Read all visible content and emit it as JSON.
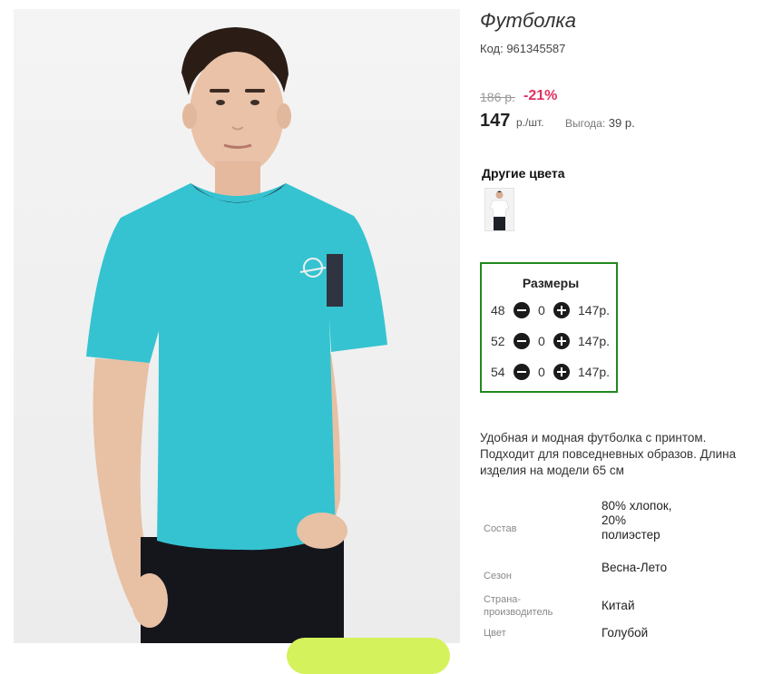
{
  "product": {
    "title": "Футболка",
    "code": "Код: 961345587",
    "old_price": "186 р.",
    "discount": "-21%",
    "price": "147",
    "price_unit": "р./шт.",
    "saving_label": "Выгода:",
    "saving_value": "39 р."
  },
  "colors": {
    "title": "Другие цвета"
  },
  "sizes": {
    "title": "Размеры",
    "rows": [
      {
        "size": "48",
        "qty": "0",
        "price": "147р."
      },
      {
        "size": "52",
        "qty": "0",
        "price": "147р."
      },
      {
        "size": "54",
        "qty": "0",
        "price": "147р."
      }
    ]
  },
  "description": "Удобная и модная футболка с принтом. Подходит для повседневных образов. Длина изделия на модели 65 см",
  "specs": {
    "composition_label": "Состав",
    "composition_value": "80% хлопок, 20% полиэстер",
    "season_label": "Сезон",
    "season_value": "Весна-Лето",
    "country_label": "Страна-производитель",
    "country_value": "Китай",
    "color_label": "Цвет",
    "color_value": "Голубой"
  },
  "colors_palette": {
    "accent_green": "#1f8a1f",
    "discount_red": "#e03060",
    "shirt": "#35c3d1"
  }
}
